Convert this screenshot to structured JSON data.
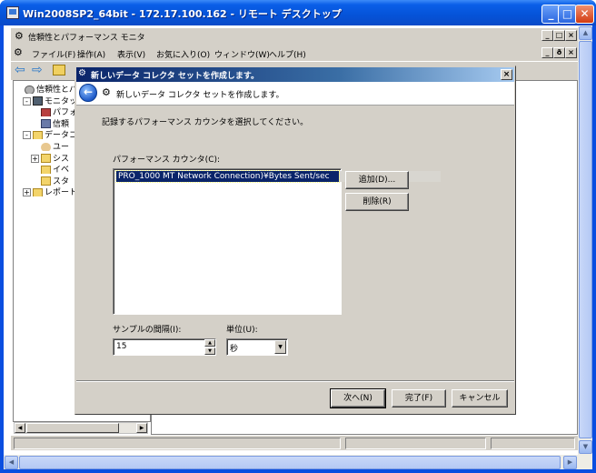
{
  "remote_desktop": {
    "title": "Win2008SP2_64bit - 172.17.100.162 - リモート デスクトップ",
    "minimize": "_",
    "maximize": "□",
    "close": "✕"
  },
  "mmc": {
    "title": "信頼性とパフォーマンス モニタ",
    "menu": {
      "file": "ファイル(F)",
      "action": "操作(A)",
      "view": "表示(V)",
      "favorites": "お気に入り(O)",
      "window": "ウィンドウ(W)",
      "help": "ヘルプ(H)"
    },
    "tree": [
      {
        "label": "信頼性とパフ",
        "indent": 0,
        "expander": "",
        "icon": "gear-icon"
      },
      {
        "label": "モニタッ",
        "indent": 1,
        "expander": "-",
        "icon": "monitor-icon"
      },
      {
        "label": "パフォ",
        "indent": 2,
        "expander": "",
        "icon": "perf-icon"
      },
      {
        "label": "信頼",
        "indent": 2,
        "expander": "",
        "icon": "reliability-icon"
      },
      {
        "label": "データコ",
        "indent": 1,
        "expander": "-",
        "icon": "folder-icon"
      },
      {
        "label": "ユー",
        "indent": 2,
        "expander": "",
        "icon": "user-icon"
      },
      {
        "label": "シス",
        "indent": 2,
        "expander": "+",
        "icon": "folder-icon"
      },
      {
        "label": "イベ",
        "indent": 2,
        "expander": "",
        "icon": "folder-icon"
      },
      {
        "label": "スタ",
        "indent": 2,
        "expander": "",
        "icon": "folder-icon"
      },
      {
        "label": "レポート",
        "indent": 1,
        "expander": "+",
        "icon": "folder-icon"
      }
    ]
  },
  "wizard": {
    "title": "新しいデータ コレクタ セットを作成します。",
    "header_title": "新しいデータ コレクタ セットを作成します。",
    "instruction": "記録するパフォーマンス カウンタを選択してください。",
    "counter_label": "パフォーマンス カウンタ(C):",
    "counters": [
      "PRO_1000 MT Network Connection)¥Bytes Sent/sec"
    ],
    "add_label": "追加(D)...",
    "remove_label": "削除(R)",
    "interval_label": "サンプルの間隔(I):",
    "interval_value": "15",
    "unit_label": "単位(U):",
    "unit_value": "秒",
    "next_label": "次へ(N)",
    "finish_label": "完了(F)",
    "cancel_label": "キャンセル"
  }
}
